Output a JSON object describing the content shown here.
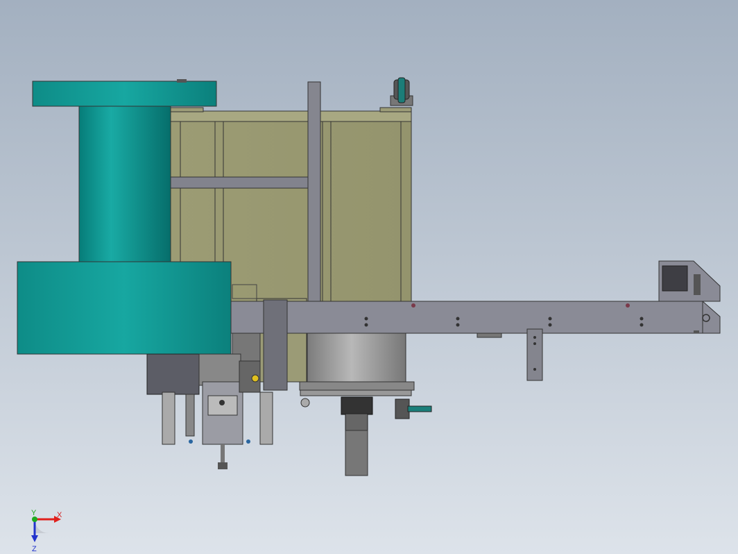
{
  "viewport": {
    "background_top": "#a3b0c0",
    "background_bottom": "#dde3ea",
    "model_colors": {
      "teal_cylinder": "#0a8f8a",
      "olive_panel": "#97976f",
      "steel_frame": "#8a8b96",
      "grey_cylinder": "#9a9a9a"
    }
  },
  "axis_triad": {
    "x_label": "X",
    "y_label": "Y",
    "z_label": "Z",
    "x_color": "#e0201c",
    "y_color": "#1faa1f",
    "z_color": "#2233cc"
  }
}
